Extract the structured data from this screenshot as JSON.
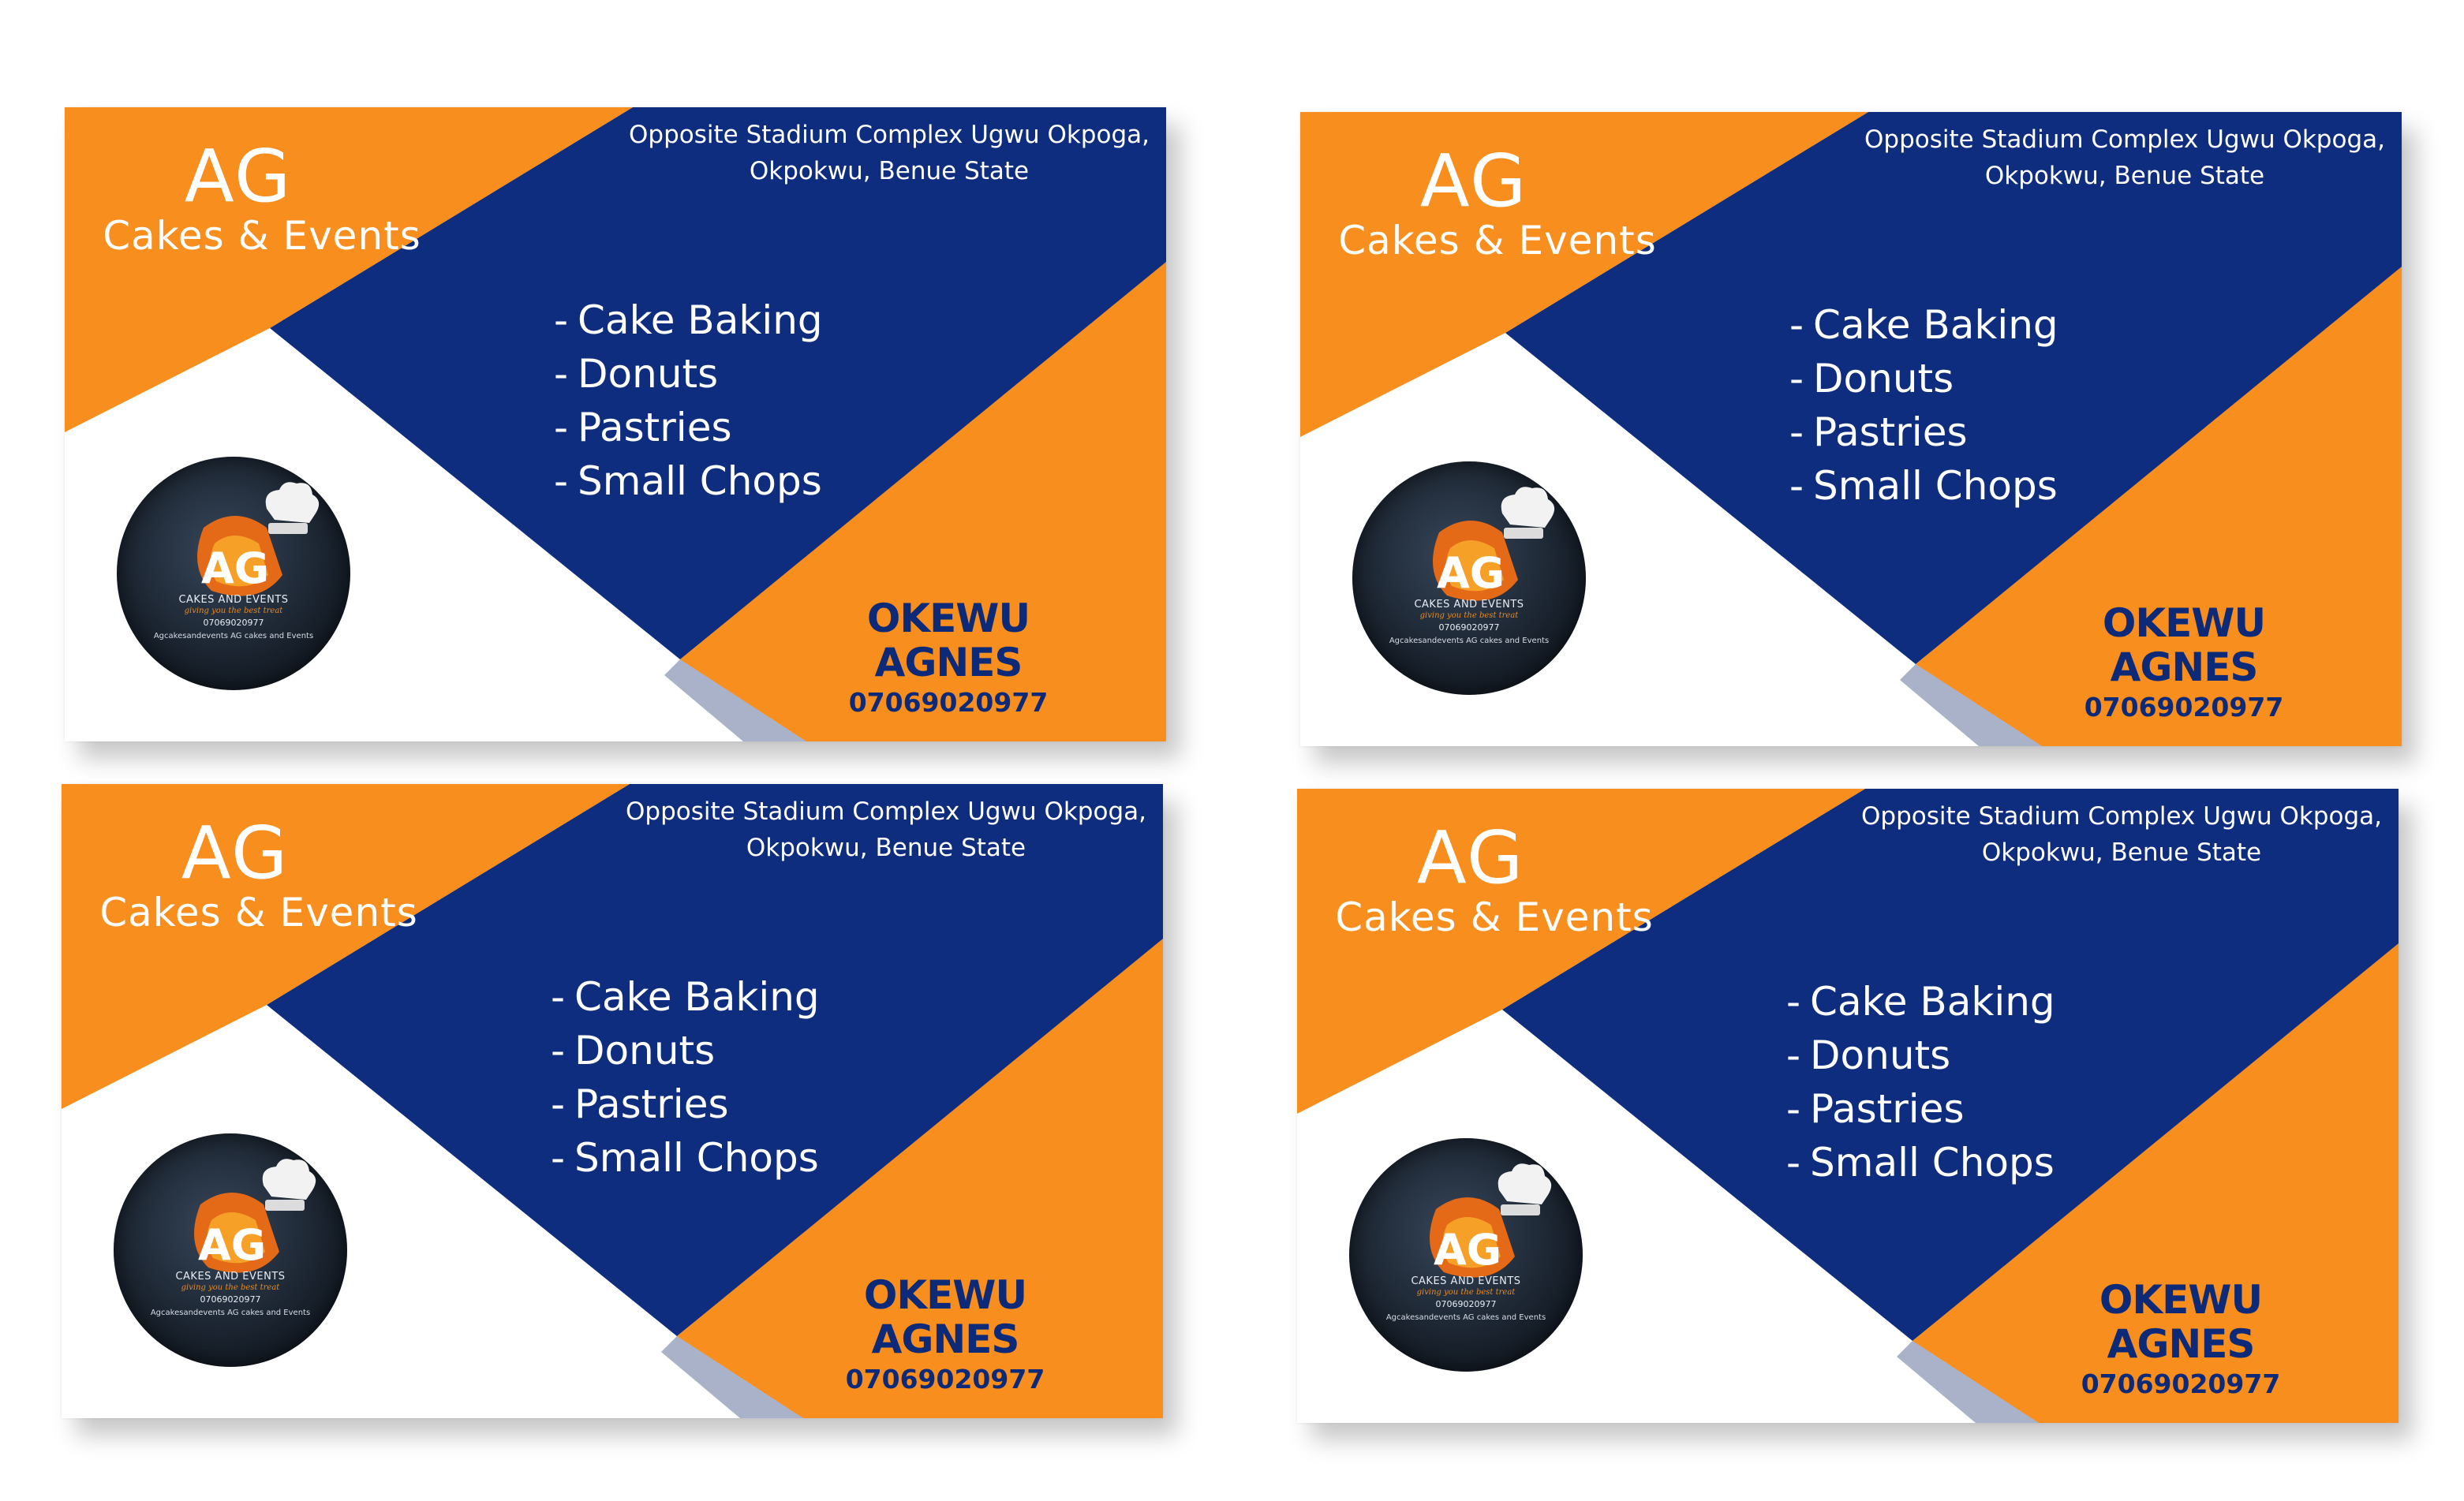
{
  "colors": {
    "orange": "#f78e1e",
    "navy": "#0f2d7e",
    "white": "#ffffff",
    "name_color": "#0d2a78"
  },
  "card": {
    "brand": "AG",
    "brand_sub": "Cakes & Events",
    "address_line1": "Opposite Stadium Complex Ugwu Okpoga,",
    "address_line2": "Okpokwu, Benue State",
    "services": [
      {
        "dash": "-",
        "label": "Cake Baking"
      },
      {
        "dash": "-",
        "label": "Donuts"
      },
      {
        "dash": "-",
        "label": "Pastries"
      },
      {
        "dash": "-",
        "label": "Small Chops"
      }
    ],
    "contact_name": "OKEWU AGNES",
    "contact_phone": "07069020977",
    "logo": {
      "monogram": "AG",
      "title": "CAKES AND EVENTS",
      "tagline": "giving you the best treat",
      "phone": "07069020977",
      "social": "Agcakesandevents  AG cakes and Events",
      "icons": [
        "chef-hat-icon",
        "instagram-icon",
        "whatsapp-icon",
        "facebook-icon"
      ]
    }
  }
}
